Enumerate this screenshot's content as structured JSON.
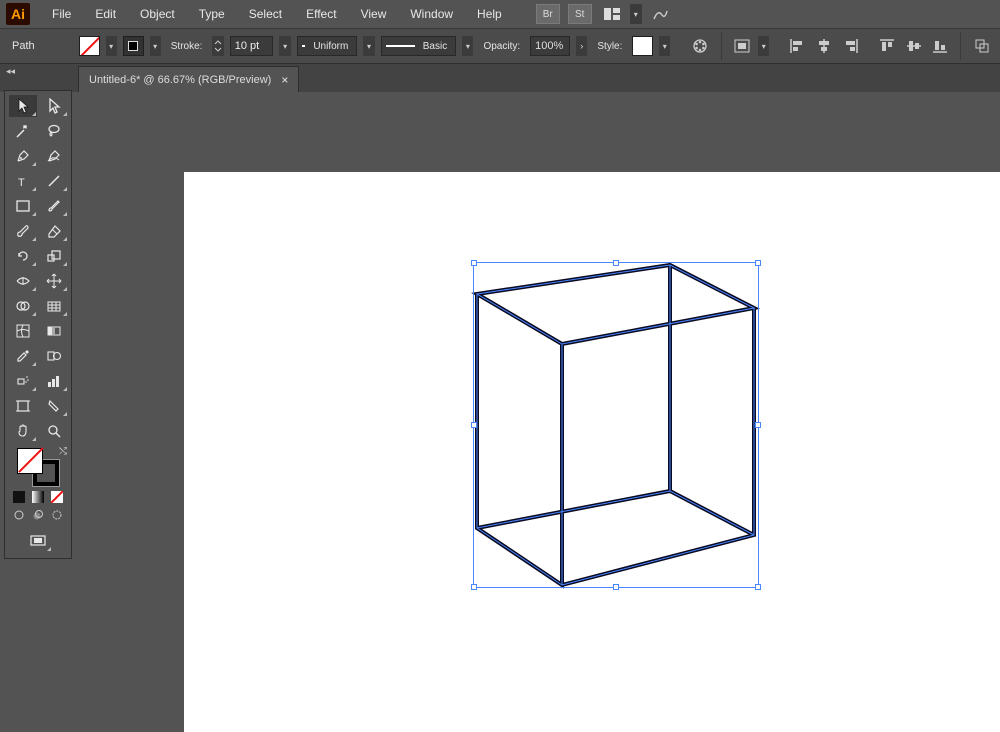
{
  "app": {
    "logo": "Ai"
  },
  "menus": [
    "File",
    "Edit",
    "Object",
    "Type",
    "Select",
    "Effect",
    "View",
    "Window",
    "Help"
  ],
  "bridge_label": "Br",
  "stock_label": "St",
  "control": {
    "selection": "Path",
    "stroke_label": "Stroke:",
    "stroke_weight": "10 pt",
    "profile_label": "Uniform",
    "brush_label": "Basic",
    "opacity_label": "Opacity:",
    "opacity_value": "100%",
    "style_label": "Style:"
  },
  "tab": {
    "title": "Untitled-6* @ 66.67% (RGB/Preview)",
    "close": "×"
  },
  "tools": {
    "left": [
      "selection",
      "magic-wand",
      "pen",
      "type",
      "rectangle",
      "shape-builder",
      "free-transform",
      "mesh",
      "artboard",
      "eyedropper",
      "slice",
      "hand"
    ],
    "right": [
      "direct-selection",
      "lasso",
      "curvature",
      "line",
      "paintbrush",
      "scissors",
      "rotate",
      "width",
      "perspective",
      "gradient",
      "blend",
      "eraser",
      "zoom"
    ]
  },
  "mini": [
    "fill-mode",
    "gradient-mode",
    "none-mode"
  ]
}
